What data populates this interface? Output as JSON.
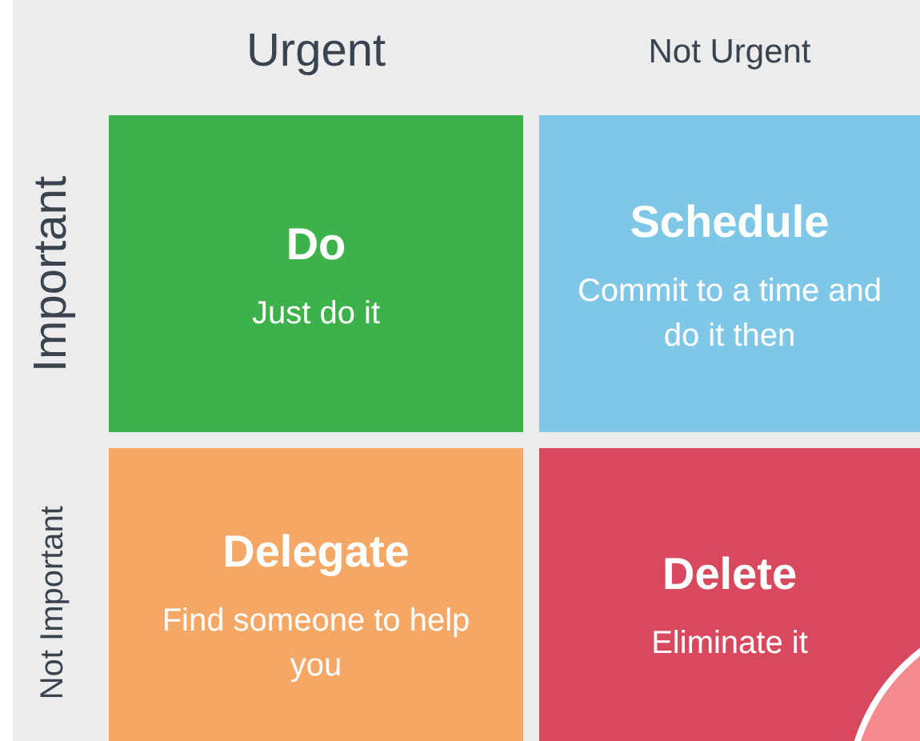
{
  "columns": [
    {
      "label": "Urgent"
    },
    {
      "label": "Not Urgent"
    }
  ],
  "rows": [
    {
      "label": "Important"
    },
    {
      "label": "Not Important"
    }
  ],
  "quadrants": [
    {
      "title": "Do",
      "subtitle": "Just do it",
      "color": "#3db24b"
    },
    {
      "title": "Schedule",
      "subtitle": "Commit to a time and do it then",
      "color": "#7fc7e6"
    },
    {
      "title": "Delegate",
      "subtitle": "Find someone to help you",
      "color": "#f5a765"
    },
    {
      "title": "Delete",
      "subtitle": "Eliminate it",
      "color": "#d8495e"
    }
  ]
}
